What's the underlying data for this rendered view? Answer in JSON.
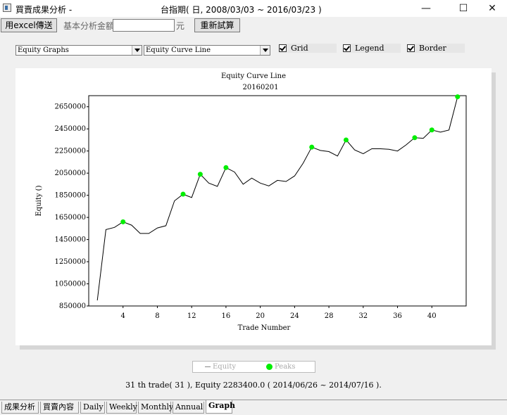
{
  "window": {
    "title": "買賣成果分析 -",
    "subtitle": "台指期( 日, 2008/03/03 ~ 2016/03/23 )",
    "minimize_glyph": "—",
    "maximize_glyph": "☐",
    "close_glyph": "✕"
  },
  "toolbar": {
    "excel_button": "用excel傳送",
    "base_amount_label": "基本分析金額",
    "base_amount_value": "",
    "currency_label": "元",
    "recalc_button": "重新試算"
  },
  "controls": {
    "graph_type": "Equity Graphs",
    "graph_style": "Equity Curve Line",
    "grid_label": "Grid",
    "legend_label": "Legend",
    "border_label": "Border",
    "grid_checked": true,
    "legend_checked": true,
    "border_checked": true
  },
  "chart_data": {
    "type": "line",
    "title": "Equity Curve Line",
    "subtitle": "20160201",
    "xlabel": "Trade Number",
    "ylabel": "Equity ()",
    "xlim": [
      0,
      44
    ],
    "ylim": [
      850000,
      2750000
    ],
    "x_ticks": [
      "4",
      "8",
      "12",
      "16",
      "20",
      "24",
      "28",
      "32",
      "36",
      "40"
    ],
    "y_ticks": [
      "850000",
      "1050000",
      "1250000",
      "1450000",
      "1650000",
      "1850000",
      "2050000",
      "2250000",
      "2450000",
      "2650000"
    ],
    "grid": true,
    "series": [
      {
        "name": "Equity",
        "color": "#000000",
        "x": [
          1,
          2,
          3,
          4,
          5,
          6,
          7,
          8,
          9,
          10,
          11,
          12,
          13,
          14,
          15,
          16,
          17,
          18,
          19,
          20,
          21,
          22,
          23,
          24,
          25,
          26,
          27,
          28,
          29,
          30,
          31,
          32,
          33,
          34,
          35,
          36,
          37,
          38,
          39,
          40,
          41,
          42,
          43
        ],
        "y": [
          900000,
          1540000,
          1560000,
          1610000,
          1580000,
          1505000,
          1505000,
          1555000,
          1575000,
          1800000,
          1860000,
          1830000,
          2040000,
          1960000,
          1930000,
          2100000,
          2060000,
          1950000,
          2005000,
          1960000,
          1935000,
          1985000,
          1975000,
          2025000,
          2140000,
          2285000,
          2255000,
          2245000,
          2205000,
          2350000,
          2260000,
          2225000,
          2270000,
          2270000,
          2265000,
          2250000,
          2305000,
          2370000,
          2365000,
          2440000,
          2420000,
          2440000,
          2740000
        ]
      },
      {
        "name": "Peaks",
        "color": "#00ee00",
        "x": [
          4,
          11,
          13,
          16,
          26,
          30,
          38,
          40,
          43
        ],
        "y": [
          1610000,
          1860000,
          2040000,
          2100000,
          2285000,
          2350000,
          2370000,
          2440000,
          2740000
        ]
      }
    ],
    "legend": [
      "Equity",
      "Peaks"
    ],
    "legend_position": "bottom-center"
  },
  "status_text": "31 th trade( 31 ), Equity  2283400.0 ( 2014/06/26 ~ 2014/07/16 ).",
  "tabs": [
    "成果分析",
    "買賣內容",
    "Daily",
    "Weekly",
    "Monthly",
    "Annual",
    "Graph"
  ],
  "active_tab": "Graph"
}
